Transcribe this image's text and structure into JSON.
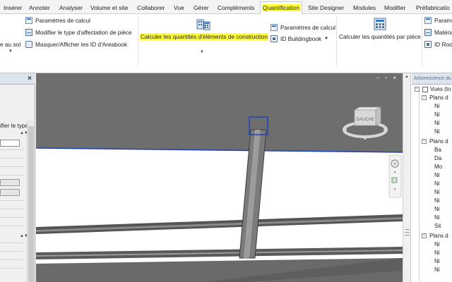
{
  "ribbon_tabs": [
    {
      "label": "Insérer",
      "active": false
    },
    {
      "label": "Annoter",
      "active": false
    },
    {
      "label": "Analyser",
      "active": false
    },
    {
      "label": "Volume et site",
      "active": false
    },
    {
      "label": "Collaborer",
      "active": false
    },
    {
      "label": "Vue",
      "active": false
    },
    {
      "label": "Gérer",
      "active": false
    },
    {
      "label": "Compléments",
      "active": false
    },
    {
      "label": "Quantification",
      "active": true
    },
    {
      "label": "Site Designer",
      "active": false
    },
    {
      "label": "Modules",
      "active": false
    },
    {
      "label": "Modifier",
      "active": false
    },
    {
      "label": "Préfabricatio",
      "active": false
    }
  ],
  "ribbon": {
    "left_truncated": "e au sol",
    "group1": {
      "params": "Paramètres de calcul",
      "modify_type": "Modifier le type d'affectation de pièce",
      "toggle_id": "Masquer/Afficher les ID d'Areabook"
    },
    "group2": {
      "big_button": "Calculer les quantités d'éléments de construction",
      "params": "Paramètres de calcul",
      "id_buildingbook": "ID Buildingbook"
    },
    "group3": {
      "big_button": "Calculer les quantités par pièce"
    },
    "group4": {
      "params": "Parame",
      "materials": "Matéria",
      "id_room": "ID Roo"
    }
  },
  "properties_panel": {
    "close": "×",
    "label": "ifier le type"
  },
  "viewport": {
    "controls": "‒ ▫ ×",
    "viewcube_face": "GAUCHE"
  },
  "project_browser": {
    "title": "Arborescence du",
    "root": "Vues (to",
    "groups": [
      {
        "label": "Plans d",
        "items": [
          "Ni",
          "Ni",
          "Ni",
          "Ni"
        ]
      },
      {
        "label": "Plans d",
        "items": [
          "Ba",
          "Da",
          "Mo",
          "Ni",
          "Ni",
          "Ni",
          "Ni",
          "Ni",
          "Ni",
          "Sit"
        ]
      },
      {
        "label": "Plans d",
        "items": [
          "Ni",
          "Ni",
          "Ni",
          "Ni"
        ]
      }
    ]
  },
  "colors": {
    "highlight": "#ffff33",
    "scene_dark": "#6e6e6e",
    "selection_blue": "#2140b8"
  }
}
